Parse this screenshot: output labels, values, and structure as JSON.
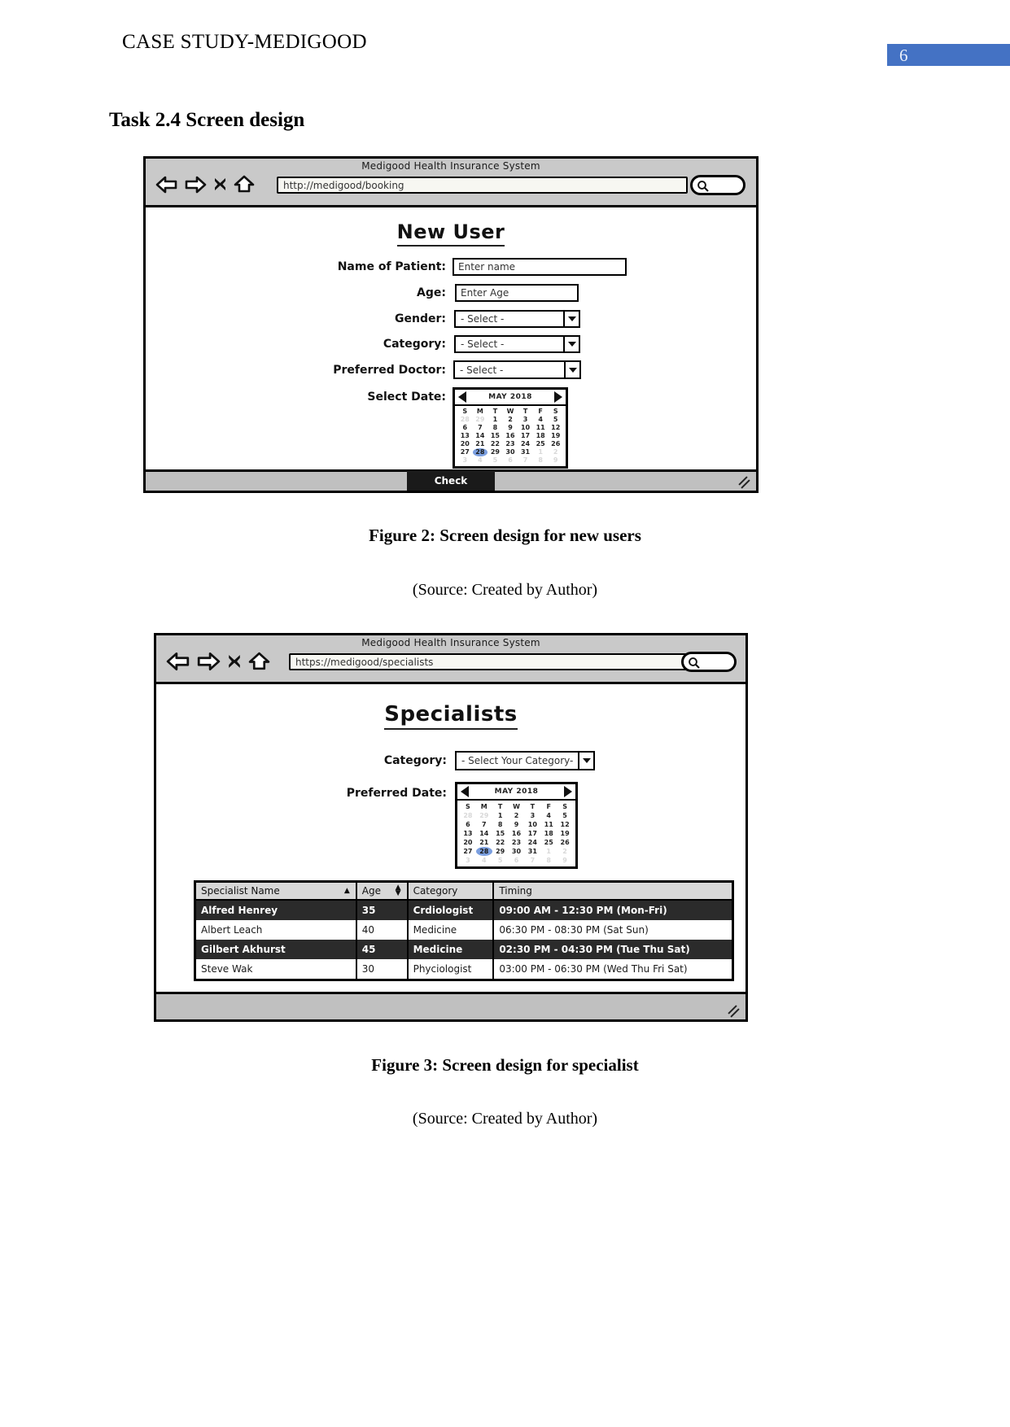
{
  "header": {
    "running_title": "CASE STUDY-MEDIGOOD",
    "page_number": "6",
    "badge_color": "#4472c4"
  },
  "section": {
    "heading": "Task 2.4 Screen design"
  },
  "figure2": {
    "browser": {
      "window_title": "Medigood Health Insurance System",
      "url": "http://medigood/booking",
      "icons": [
        "back-arrow-icon",
        "forward-arrow-icon",
        "close-icon",
        "home-icon",
        "search-icon"
      ]
    },
    "screen_title": "New User",
    "fields": [
      {
        "label": "Name of Patient:",
        "type": "text",
        "value": "Enter name"
      },
      {
        "label": "Age:",
        "type": "text",
        "value": "Enter Age"
      },
      {
        "label": "Gender:",
        "type": "select",
        "value": "- Select -"
      },
      {
        "label": "Category:",
        "type": "select",
        "value": "- Select -"
      },
      {
        "label": "Preferred Doctor:",
        "type": "select",
        "value": "- Select -"
      },
      {
        "label": "Select Date:",
        "type": "calendar",
        "value": ""
      }
    ],
    "calendar": {
      "month": "MAY 2018",
      "dow": [
        "S",
        "M",
        "T",
        "W",
        "T",
        "F",
        "S"
      ],
      "lead_blanks": 2,
      "days": 31,
      "selected": 28,
      "prev_icon": "chevron-left-icon",
      "next_icon": "chevron-right-icon"
    },
    "footer": {
      "check_label": "Check"
    },
    "caption": "Figure 2: Screen design for new users",
    "source": "(Source: Created by Author)"
  },
  "figure3": {
    "browser": {
      "window_title": "Medigood Health Insurance System",
      "url": "https://medigood/specialists",
      "icons": [
        "back-arrow-icon",
        "forward-arrow-icon",
        "close-icon",
        "home-icon",
        "search-icon"
      ]
    },
    "screen_title": "Specialists",
    "fields": [
      {
        "label": "Category:",
        "type": "select",
        "value": "- Select Your Category-"
      },
      {
        "label": "Preferred Date:",
        "type": "calendar",
        "value": ""
      }
    ],
    "calendar": {
      "month": "MAY 2018",
      "dow": [
        "S",
        "M",
        "T",
        "W",
        "T",
        "F",
        "S"
      ],
      "lead_blanks": 2,
      "days": 31,
      "selected": 28,
      "prev_icon": "chevron-left-icon",
      "next_icon": "chevron-right-icon"
    },
    "table": {
      "columns": [
        "Specialist Name",
        "Age",
        "Category",
        "Timing"
      ],
      "sort_indicators": [
        "ascending",
        "both",
        "",
        ""
      ],
      "rows": [
        {
          "name": "Alfred Henrey",
          "age": "35",
          "category": "Crdiologist",
          "timing": "09:00 AM - 12:30 PM (Mon-Fri)",
          "style": "dark"
        },
        {
          "name": "Albert Leach",
          "age": "40",
          "category": "Medicine",
          "timing": "06:30 PM - 08:30 PM (Sat Sun)",
          "style": "light"
        },
        {
          "name": "Gilbert Akhurst",
          "age": "45",
          "category": "Medicine",
          "timing": "02:30 PM - 04:30 PM (Tue Thu Sat)",
          "style": "dark"
        },
        {
          "name": "Steve Wak",
          "age": "30",
          "category": "Phyciologist",
          "timing": "03:00 PM - 06:30 PM (Wed Thu Fri Sat)",
          "style": "light"
        }
      ]
    },
    "caption": "Figure 3: Screen design for specialist",
    "source": "(Source: Created by Author)"
  }
}
